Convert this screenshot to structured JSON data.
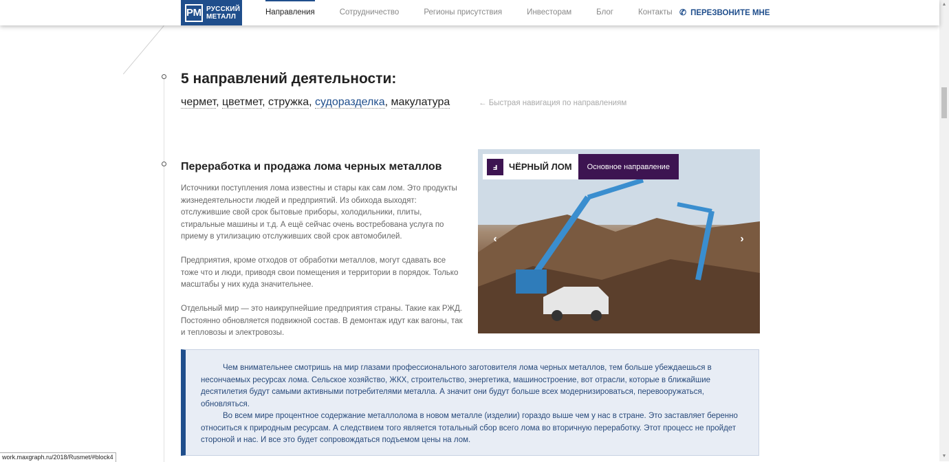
{
  "header": {
    "logo_mark": "РМ",
    "logo_line1": "РУССКИЙ",
    "logo_line2": "МЕТАЛЛ",
    "nav": [
      {
        "label": "Направления"
      },
      {
        "label": "Сотрудничество"
      },
      {
        "label": "Регионы присутствия"
      },
      {
        "label": "Инвесторам"
      },
      {
        "label": "Блог"
      },
      {
        "label": "Контакты"
      }
    ],
    "callback_label": "ПЕРЕЗВОНИТЕ МНЕ",
    "callback_icon": "phone-icon"
  },
  "section": {
    "title": "5 направлений деятельности:",
    "directions": [
      {
        "label": "чермет",
        "sep": ", "
      },
      {
        "label": "цветмет",
        "sep": ", "
      },
      {
        "label": "стружка",
        "sep": ", "
      },
      {
        "label": "судоразделка",
        "sep": ", "
      },
      {
        "label": "макулатура",
        "sep": ""
      }
    ],
    "quick_nav": "← Быстрая навигация по направлениям"
  },
  "article": {
    "title": "Переработка и продажа лома черных металлов",
    "paragraphs": [
      "Источники поступления лома известны и стары как сам лом. Это продукты жизнедеятельности людей и предприятий. Из обихода выходят: отслужившие свой срок бытовые приборы, холодильники, плиты, стиральные машины и т.д. А ещё сейчас очень востребована услуга по приему в утилизацию отслуживших свой срок автомобилей.",
      "Предприятия, кроме отходов от обработки металлов, могут сдавать все тоже что и люди, приводя свои помещения и территории в порядок. Только масштабы у них куда значительнее.",
      "Отдельный мир — это наикрупнейшие предприятия страны. Такие как РЖД. Постоянно обновляется подвижной состав. В демонтаж идут как вагоны, так и тепловозы и электровозы."
    ]
  },
  "slider": {
    "badge_title": "ЧЁРНЫЙ ЛОМ",
    "badge_tag": "Основное направление",
    "badge_icon": "scrap-metal-icon",
    "prev_arrow": "‹",
    "next_arrow": "›"
  },
  "quote": {
    "paragraphs": [
      "Чем внимательнее смотришь на мир глазами профессионального заготовителя лома черных металлов, тем больше убеждаешься в несончаемых ресурсах лома. Сельское хозяйство, ЖКХ, строительство, энергетика, машиностроение, вот отрасли, которые в ближайшие десятилетия будут самыми активными потребителями металла. А значит они будут больше всех модернизироваться, перевооружаться, обновляться.",
      "Во всем мире процентное содержание металлолома в новом металле (изделии) гораздо выше чем у нас в стране. Это заставляет беренно относиться к природным ресурсам. А следствием того является тотальный сбор всего лома во вторичную переработку. Этот процесс не пройдет стороной и нас. И все это будет сопровождаться подъемом цены на лом."
    ]
  },
  "status_url": "work.maxgraph.ru/2018/Rusmet/#block4",
  "colors": {
    "brand": "#1f4e8c",
    "badge": "#3d1451",
    "quote_bg": "#e8edf5"
  }
}
